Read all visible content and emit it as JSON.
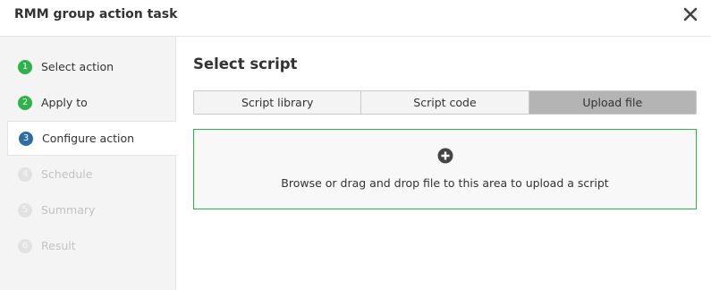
{
  "dialog": {
    "title": "RMM group action task",
    "close_icon": "close-icon"
  },
  "steps": [
    {
      "number": "1",
      "label": "Select action",
      "state": "done"
    },
    {
      "number": "2",
      "label": "Apply to",
      "state": "done"
    },
    {
      "number": "3",
      "label": "Configure action",
      "state": "current"
    },
    {
      "number": "4",
      "label": "Schedule",
      "state": "pending"
    },
    {
      "number": "5",
      "label": "Summary",
      "state": "pending"
    },
    {
      "number": "6",
      "label": "Result",
      "state": "pending"
    }
  ],
  "main": {
    "title": "Select script",
    "tabs": [
      {
        "label": "Script library",
        "selected": false
      },
      {
        "label": "Script code",
        "selected": false
      },
      {
        "label": "Upload file",
        "selected": true
      }
    ],
    "dropzone": {
      "icon": "plus-circle-icon",
      "text": "Browse or drag and drop file to this area to upload a script"
    }
  },
  "colors": {
    "done": "#2db34a",
    "current": "#2e6da4",
    "pending": "#e2e2e2",
    "dropzone_border": "#2db34a",
    "selected_tab": "#b4b4b4"
  }
}
